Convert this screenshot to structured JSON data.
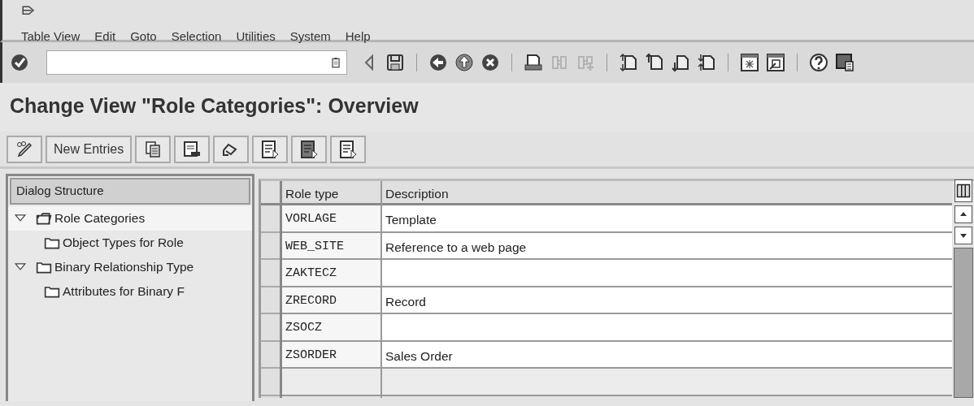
{
  "menu": [
    "Table View",
    "Edit",
    "Goto",
    "Selection",
    "Utilities",
    "System",
    "Help"
  ],
  "standard_toolbar": [
    {
      "disabled": false
    },
    {
      "disabled": false
    },
    {
      "disabled": false
    },
    {
      "disabled": false
    },
    {
      "disabled": false
    },
    {
      "disabled": false
    },
    {
      "disabled": false
    },
    {
      "disabled": true
    },
    {
      "disabled": true
    },
    {
      "disabled": false
    },
    {
      "disabled": false
    },
    {
      "disabled": false
    },
    {
      "disabled": false
    },
    {
      "disabled": false
    },
    {
      "disabled": false
    },
    {
      "disabled": false
    },
    {
      "disabled": false
    }
  ],
  "title": "Change View \"Role Categories\": Overview",
  "app_toolbar": {
    "new_entries": "New Entries"
  },
  "dialog_structure": {
    "title": "Dialog Structure",
    "items": [
      {
        "label": "Role Categories",
        "expanded": true,
        "selected": true,
        "children": [
          {
            "label": "Object Types for Role",
            "selected": false
          }
        ]
      },
      {
        "label": "Binary Relationship Type",
        "expanded": true,
        "selected": false,
        "children": [
          {
            "label": "Attributes for Binary F",
            "selected": false
          }
        ]
      }
    ]
  },
  "table": {
    "columns": [
      "Role type",
      "Description"
    ],
    "rows": [
      {
        "role_type": "VORLAGE",
        "description": "Template"
      },
      {
        "role_type": "WEB_SITE",
        "description": "Reference to a web page"
      },
      {
        "role_type": "ZAKTECZ"
      },
      {
        "role_type": "ZRECORD",
        "description": "Record"
      },
      {
        "role_type": "ZSOCZ"
      },
      {
        "role_type": "ZSORDER",
        "description": "Sales Order"
      }
    ]
  }
}
